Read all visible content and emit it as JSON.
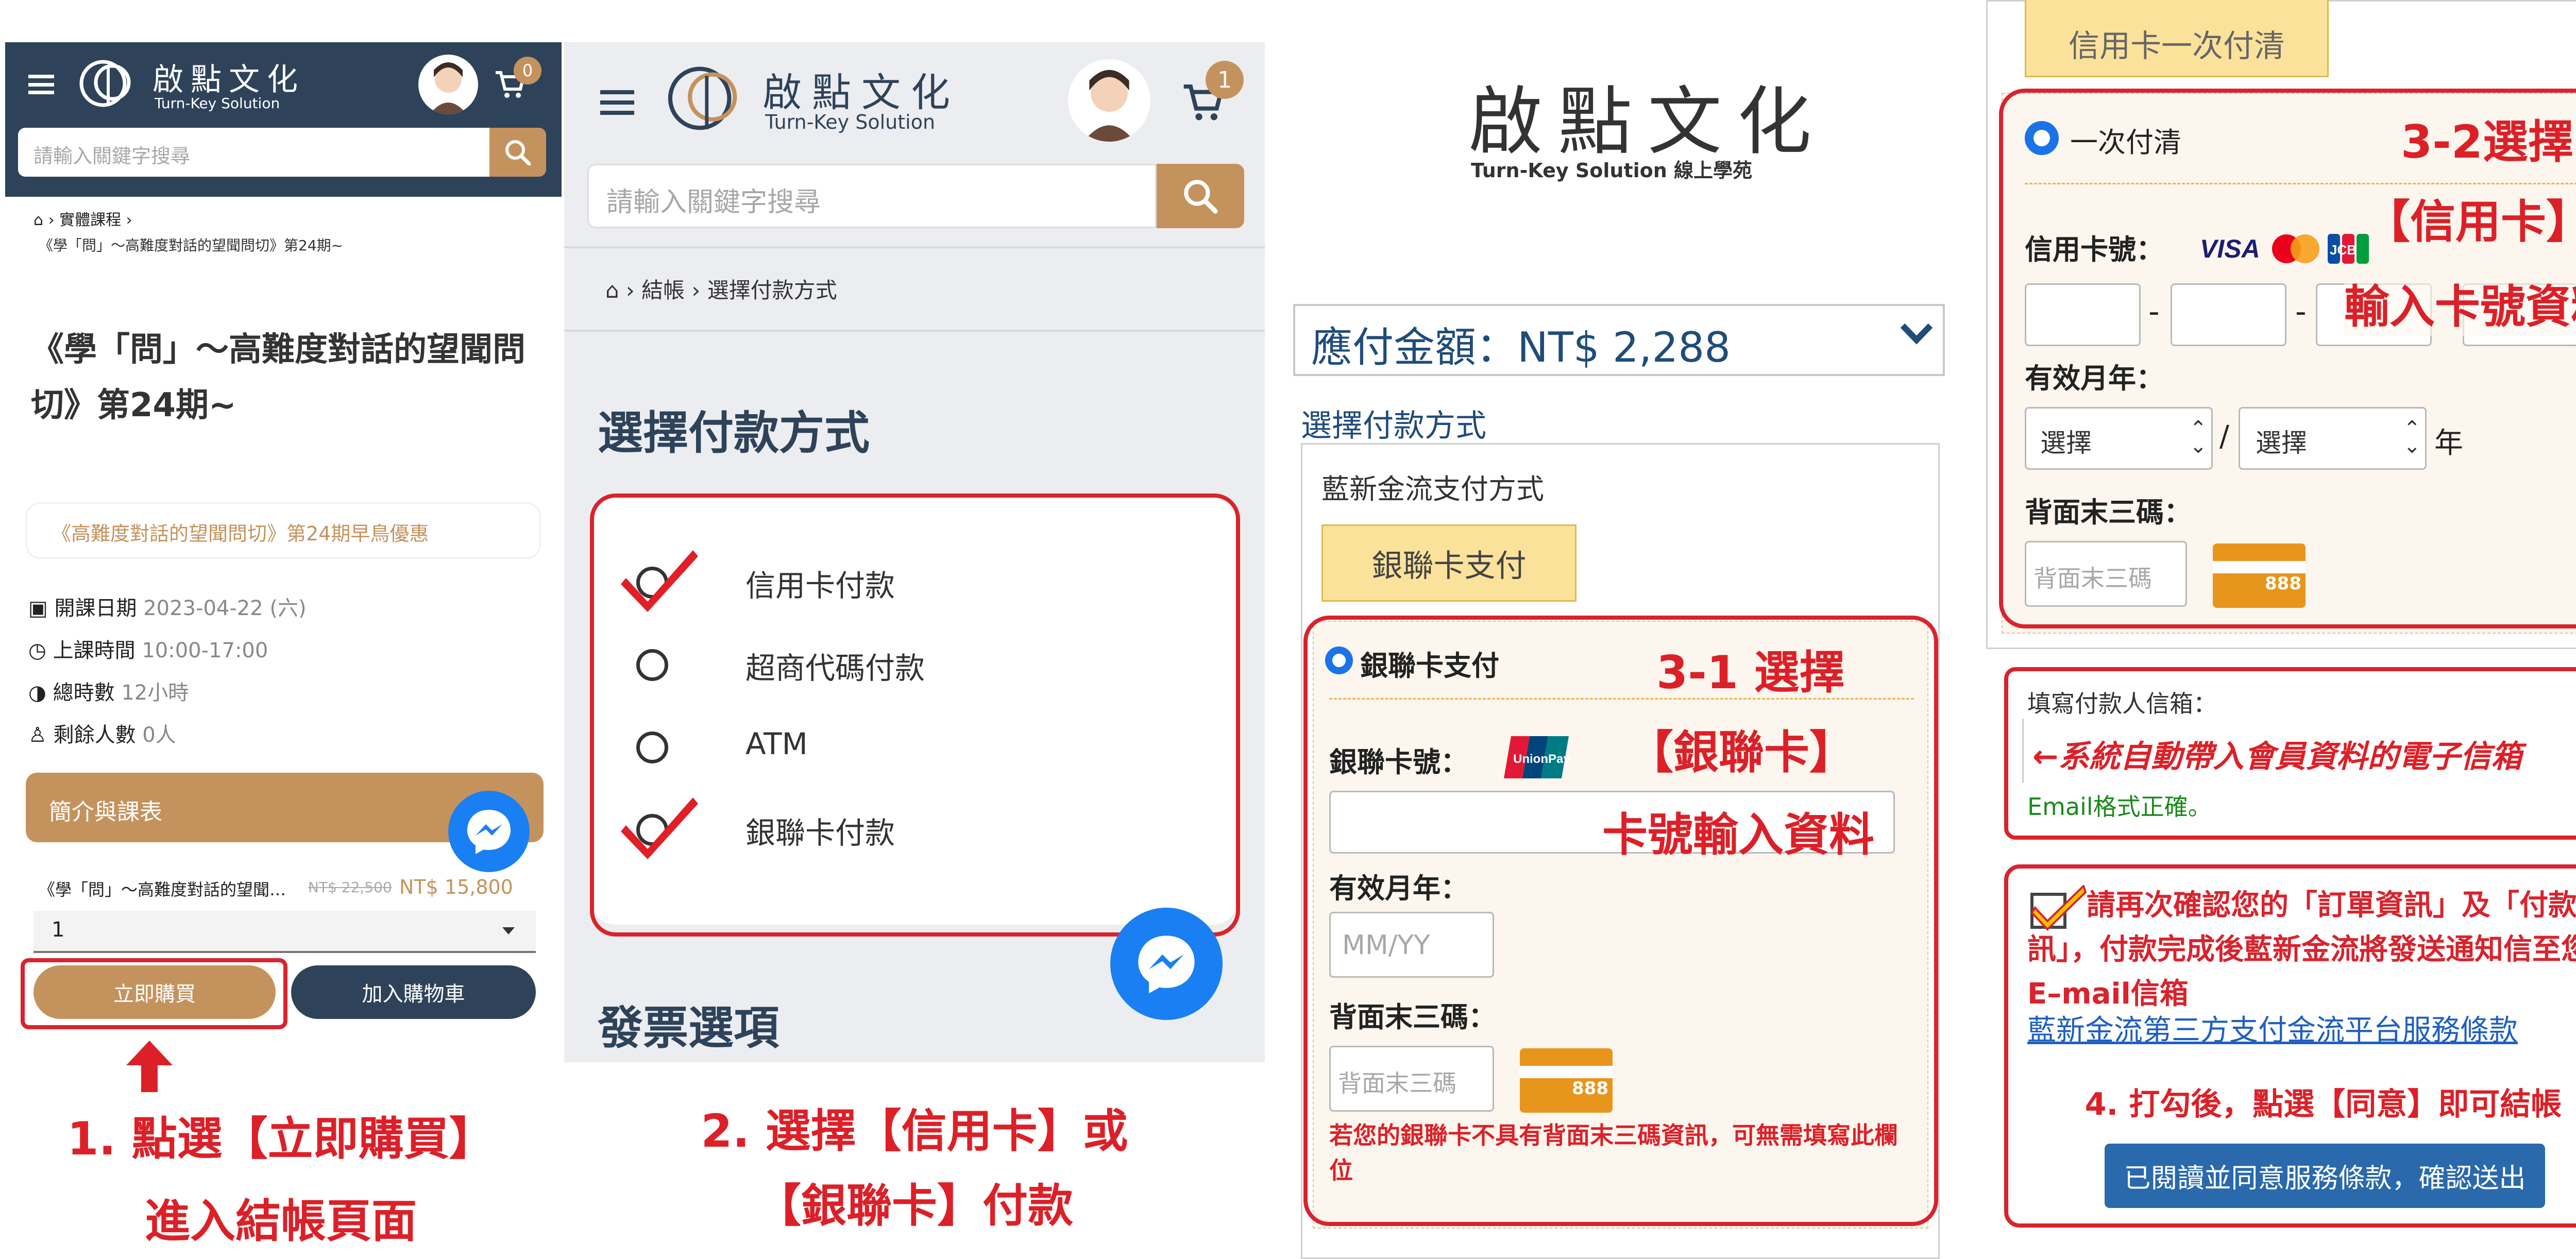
{
  "panel1": {
    "brand": "啟點文化",
    "brand_en": "Turn-Key Solution",
    "cart_count": "0",
    "search_placeholder": "請輸入關鍵字搜尋",
    "breadcrumb_cat": "實體課程",
    "breadcrumb_page": "《學「問」～高難度對話的望聞問切》第24期~",
    "course_title": "《學「問」～高難度對話的望聞問切》第24期~",
    "promo": "《高難度對話的望聞問切》第24期早鳥優惠",
    "info": [
      {
        "label": "開課日期",
        "value": "2023-04-22 (六)"
      },
      {
        "label": "上課時間",
        "value": "10:00-17:00"
      },
      {
        "label": "總時數",
        "value": "12小時"
      },
      {
        "label": "剩餘人數",
        "value": "0人"
      }
    ],
    "tab_label": "簡介與課表",
    "item_name": "《學「問」～高難度對話的望聞…",
    "old_price": "NT$ 22,500",
    "price": "NT$ 15,800",
    "qty": "1",
    "buy_now": "立即購買",
    "add_cart": "加入購物車",
    "step_line1": "1. 點選【立即購買】",
    "step_line2": "進入結帳頁面"
  },
  "panel2": {
    "brand": "啟點文化",
    "brand_en": "Turn-Key Solution",
    "cart_count": "1",
    "search_placeholder": "請輸入關鍵字搜尋",
    "breadcrumb1": "結帳",
    "breadcrumb2": "選擇付款方式",
    "heading": "選擇付款方式",
    "options": [
      "信用卡付款",
      "超商代碼付款",
      "ATM",
      "銀聯卡付款"
    ],
    "invoice_heading": "發票選項",
    "step_line1": "2. 選擇【信用卡】或",
    "step_line2": "【銀聯卡】付款"
  },
  "panel3": {
    "brand": "啟點文化",
    "brand_en": "Turn-Key Solution 線上學苑",
    "amount": "應付金額：NT$ 2,288",
    "method_title": "選擇付款方式",
    "provider": "藍新金流支付方式",
    "union_tab": "銀聯卡支付",
    "union_radio": "銀聯卡支付",
    "card_no_label": "銀聯卡號：",
    "expiry_label": "有效月年：",
    "expiry_placeholder": "MM/YY",
    "cvv_label": "背面末三碼：",
    "cvv_placeholder": "背面末三碼",
    "cvv_icon_text": "888",
    "note": "若您的銀聯卡不具有背面末三碼資訊，可無需填寫此欄位",
    "ann1": "3-1 選擇",
    "ann2": "【銀聯卡】",
    "ann3": "卡號輸入資料"
  },
  "panel4": {
    "top_tab": "信用卡一次付清",
    "radio_label": "一次付清",
    "card_no_label": "信用卡號：",
    "expiry_label": "有效月年：",
    "select1": "選擇",
    "select2": "選擇",
    "slash": "/",
    "year": "年",
    "cvv_label": "背面末三碼：",
    "cvv_placeholder": "背面末三碼",
    "cvv_icon_text": "888",
    "ann1": "3-2選擇",
    "ann2": "【信用卡】",
    "ann3": "輸入卡號資料",
    "email_label": "填寫付款人信箱：",
    "email_ann": "←系統自動帶入會員資料的電子信箱",
    "email_ok": "Email格式正確。",
    "confirm_text": "請再次確認您的「訂單資訊」及「付款資訊」，付款完成後藍新金流將發送通知信至您的E–mail信箱",
    "terms_link": "藍新金流第三方支付金流平台服務條款",
    "step4": "4. 打勾後，點選【同意】即可結帳",
    "submit": "已閱讀並同意服務條款，確認送出"
  },
  "colors": {
    "navy": "#2e435a",
    "tan": "#c4935d",
    "red": "#d9232d",
    "yellow": "#fbe29b",
    "blue": "#2a69ac",
    "messenger": "#1a7ff2"
  }
}
